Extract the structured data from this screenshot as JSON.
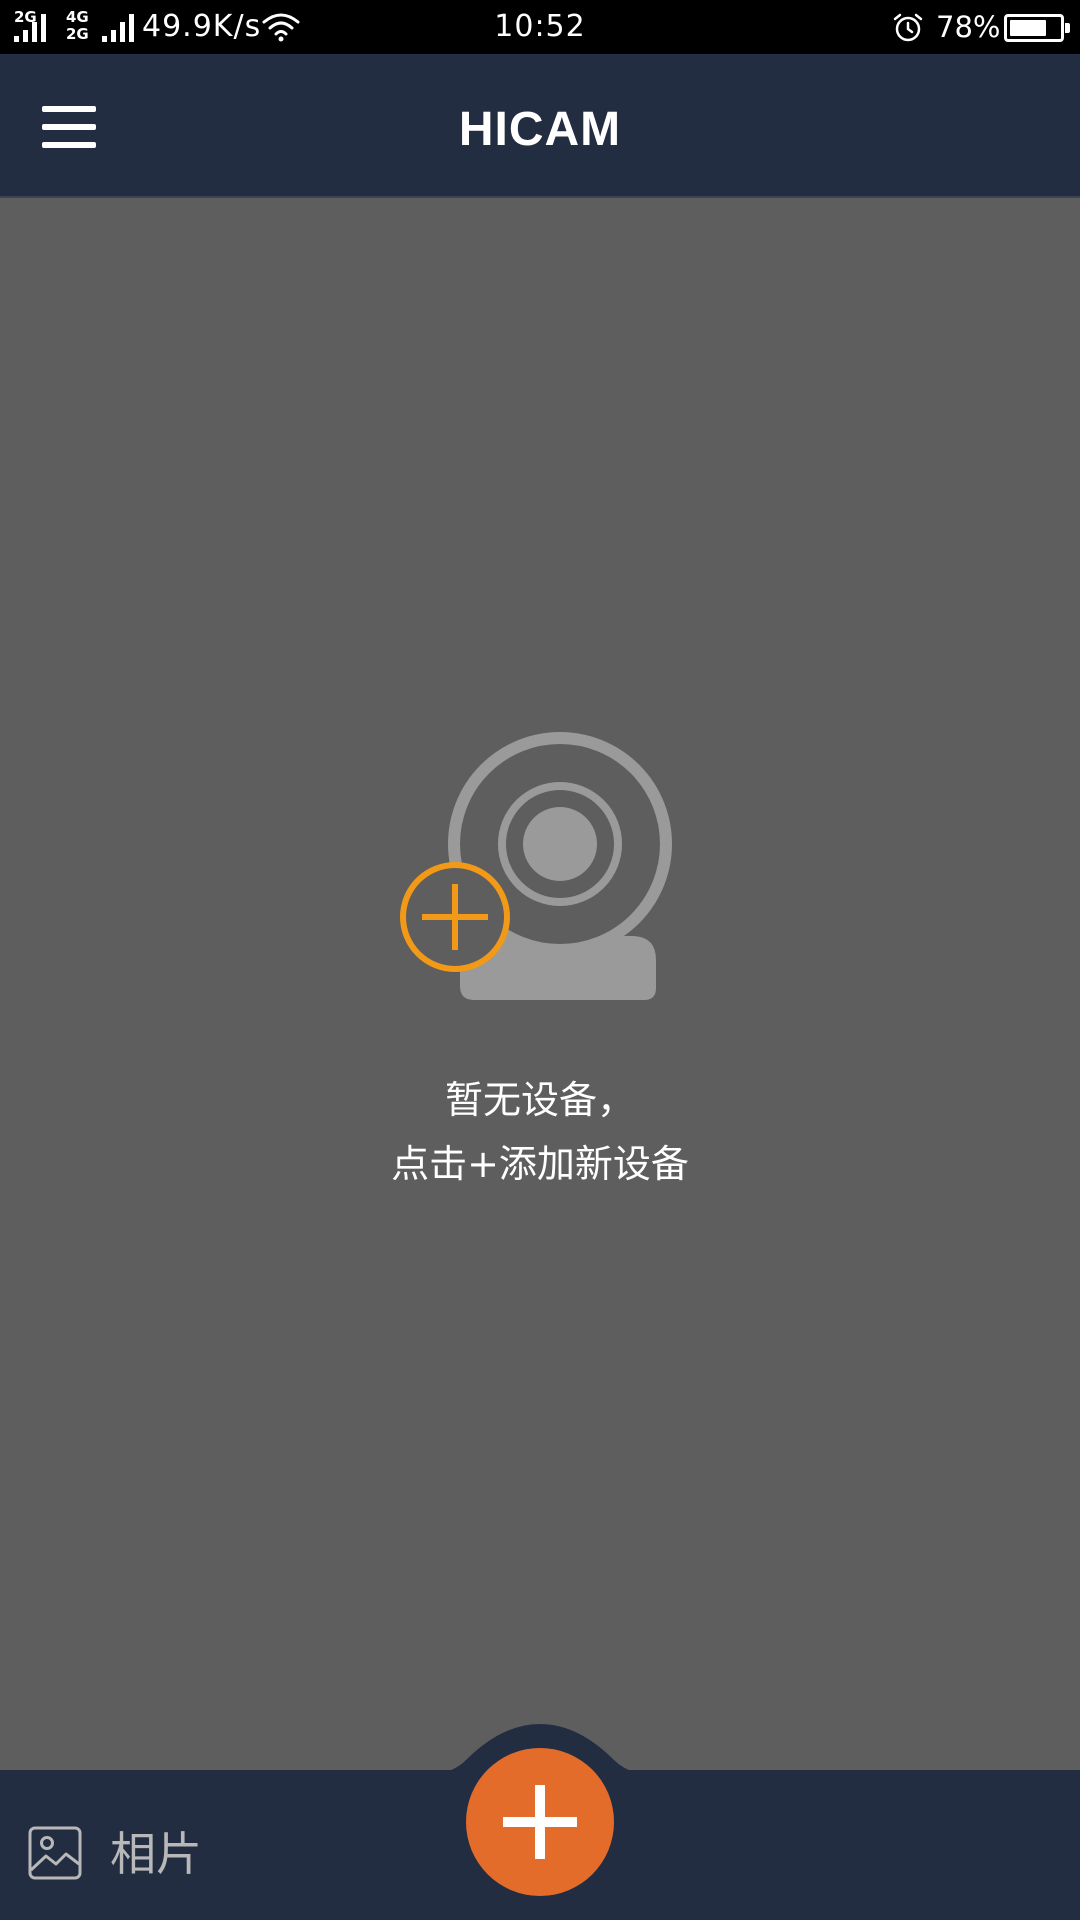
{
  "status_bar": {
    "sim1_tag": "2G",
    "sim2_tag_top": "4G",
    "sim2_tag_bottom": "2G",
    "net_speed": "49.9K/s",
    "time": "10:52",
    "battery_percent": "78%",
    "battery_level": 0.78,
    "icons": [
      "signal-icon",
      "wifi-icon",
      "alarm-icon",
      "battery-icon"
    ]
  },
  "header": {
    "title": "HICAM",
    "menu_icon": "menu-icon"
  },
  "empty_state": {
    "illustration_icon": "webcam-add-icon",
    "line1": "暂无设备，",
    "line2": "点击+添加新设备"
  },
  "bottom_bar": {
    "photos_label": "相片",
    "photos_icon": "image-icon",
    "add_icon": "plus-icon"
  },
  "colors": {
    "status_bar_bg": "#000000",
    "header_bg": "#232d42",
    "content_bg": "#5e5e5e",
    "accent_orange": "#e46c2b",
    "plus_yellow": "#f29a17",
    "camera_gray": "#9a9a9a"
  }
}
